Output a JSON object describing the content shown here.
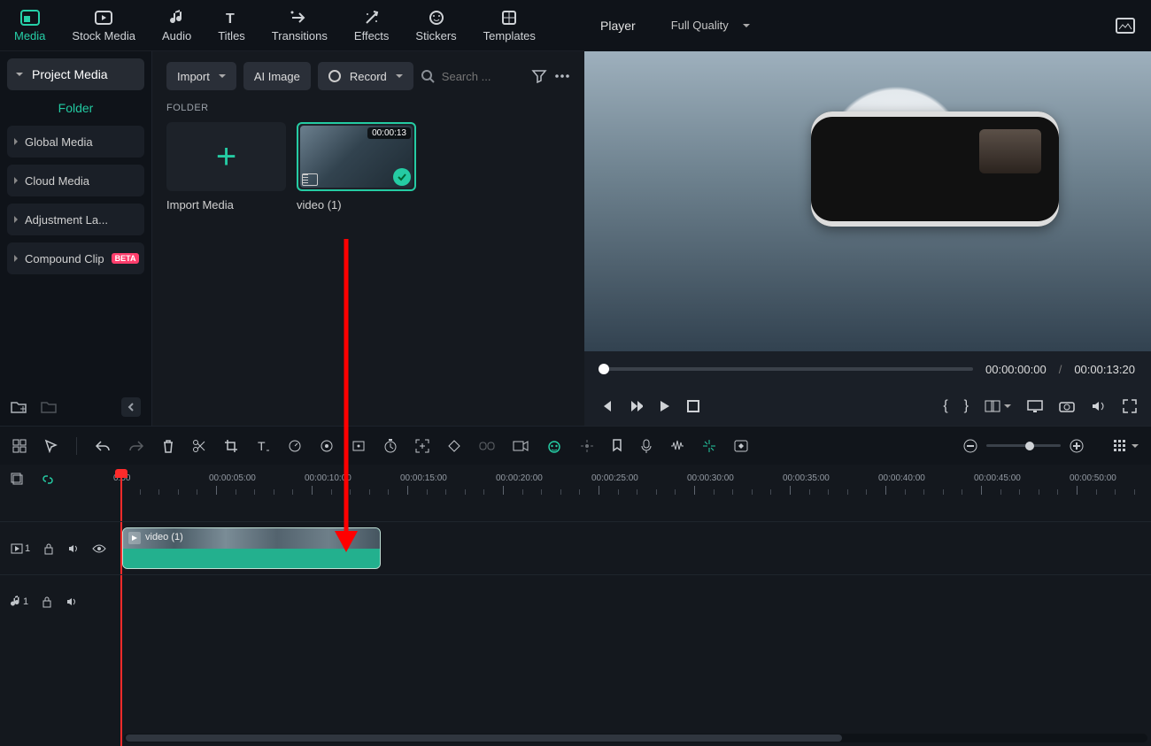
{
  "top_tabs": {
    "media": "Media",
    "stock": "Stock Media",
    "audio": "Audio",
    "titles": "Titles",
    "transitions": "Transitions",
    "effects": "Effects",
    "stickers": "Stickers",
    "templates": "Templates"
  },
  "sidebar": {
    "header": "Project Media",
    "folder_tab": "Folder",
    "items": {
      "global": "Global Media",
      "cloud": "Cloud Media",
      "adjust": "Adjustment La...",
      "compound": "Compound Clip",
      "beta": "BETA"
    }
  },
  "browser": {
    "import": "Import",
    "ai_image": "AI Image",
    "record": "Record",
    "search_placeholder": "Search ...",
    "section": "FOLDER",
    "import_media": "Import Media",
    "clip_name": "video (1)",
    "clip_duration": "00:00:13"
  },
  "player": {
    "label": "Player",
    "quality": "Full Quality",
    "current": "00:00:00:00",
    "sep": "/",
    "total": "00:00:13:20"
  },
  "ruler": [
    "0:00",
    "00:00:05:00",
    "00:00:10:00",
    "00:00:15:00",
    "00:00:20:00",
    "00:00:25:00",
    "00:00:30:00",
    "00:00:35:00",
    "00:00:40:00",
    "00:00:45:00",
    "00:00:50:00"
  ],
  "track": {
    "video_idx": "1",
    "audio_idx": "1",
    "clip_label": "video (1)"
  }
}
